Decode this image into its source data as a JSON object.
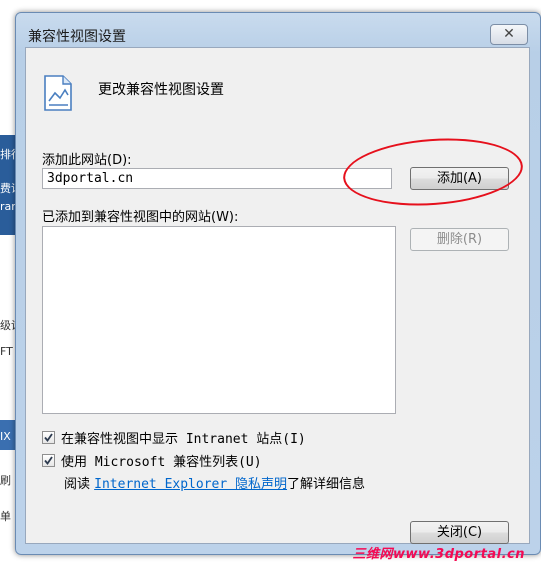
{
  "background": {
    "fragments": [
      "排行",
      "费讯",
      "ran",
      "级设",
      "FT",
      "IX",
      "刷",
      "单"
    ]
  },
  "dialog": {
    "title": "兼容性视图设置",
    "close_symbol": "✕",
    "header": "更改兼容性视图设置",
    "add_site_label": "添加此网站(D):",
    "add_site_value": "3dportal.cn",
    "add_button": "添加(A)",
    "list_label": "已添加到兼容性视图中的网站(W):",
    "remove_button": "删除(R)",
    "options": [
      {
        "label": "在兼容性视图中显示 Intranet 站点(I)",
        "checked": true
      },
      {
        "label": "使用 Microsoft 兼容性列表(U)",
        "checked": true
      }
    ],
    "privacy": {
      "prefix": "阅读 ",
      "link": "Internet Explorer 隐私声明",
      "suffix": "了解详细信息"
    },
    "close_button": "关闭(C)"
  },
  "watermark": "三维网www.3dportal.cn",
  "colors": {
    "annotation_circle": "#e6101c",
    "link": "#0066cc",
    "watermark": "#f40a53"
  }
}
